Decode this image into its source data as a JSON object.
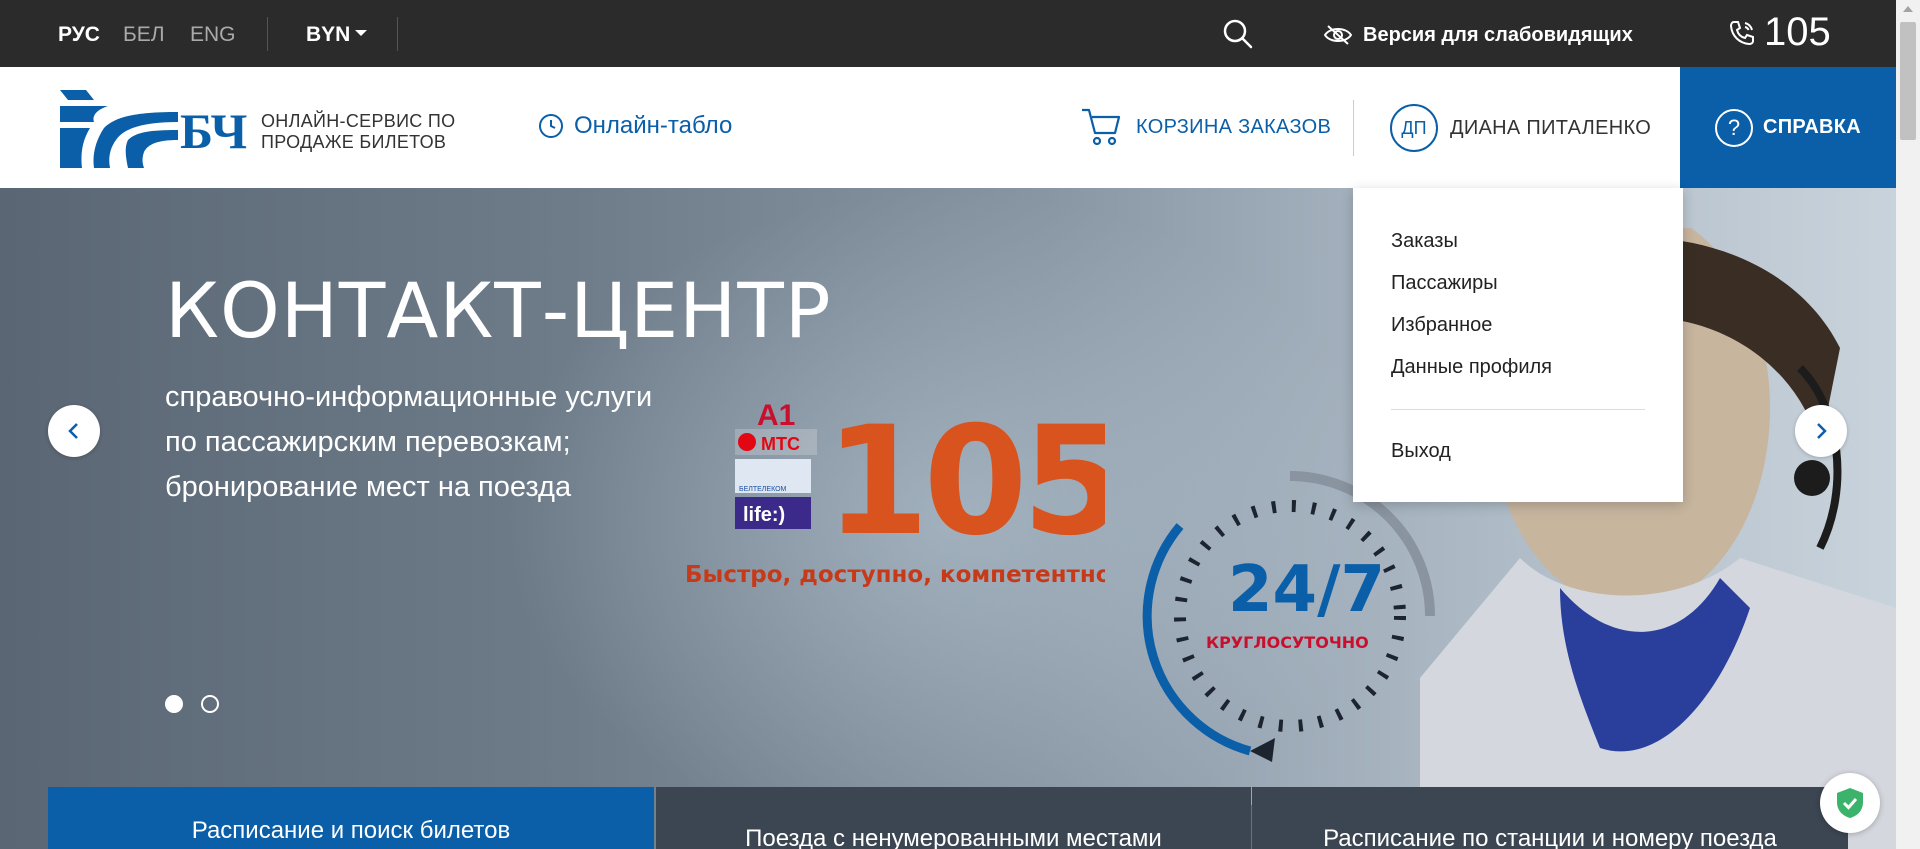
{
  "topbar": {
    "languages": [
      "РУС",
      "БЕЛ",
      "ENG"
    ],
    "currency": "BYN",
    "visually_impaired_label": "Версия для слабовидящих",
    "phone": "105"
  },
  "header": {
    "logo_letters": "БЧ",
    "logo_text_line1": "ОНЛАЙН-СЕРВИС ПО",
    "logo_text_line2": "ПРОДАЖЕ БИЛЕТОВ",
    "online_board": "Онлайн-табло",
    "cart": "КОРЗИНА ЗАКАЗОВ",
    "user_initials": "ДП",
    "user_name": "ДИАНА ПИТАЛЕНКО",
    "help": "СПРАВКА"
  },
  "user_menu": {
    "items": [
      "Заказы",
      "Пассажиры",
      "Избранное",
      "Данные профиля"
    ],
    "logout": "Выход"
  },
  "hero": {
    "title": "КОНТАКТ-ЦЕНТР",
    "subtitle_lines": [
      "справочно-информационные услуги",
      "по пассажирским перевозкам;",
      "бронирование мест на поезда"
    ],
    "promo_number": "105",
    "promo_tagline": "Быстро, доступно, компетентно!",
    "promo_mts": "МТС",
    "promo_a1": "A1",
    "promo_life": "life:)",
    "promo_beltelecom": "БЕЛТЕЛЕКОМ",
    "clock_main": "24/7",
    "clock_sub": "КРУГЛОСУТОЧНО",
    "slides_count": 2,
    "active_slide": 1
  },
  "tabs": [
    "Расписание и поиск билетов",
    "Поезда с ненумерованными местами",
    "Расписание по станции и номеру поезда"
  ],
  "colors": {
    "brand_blue": "#0a5fa8",
    "topbar_bg": "#2b2b2b",
    "promo_orange": "#d9531e"
  }
}
